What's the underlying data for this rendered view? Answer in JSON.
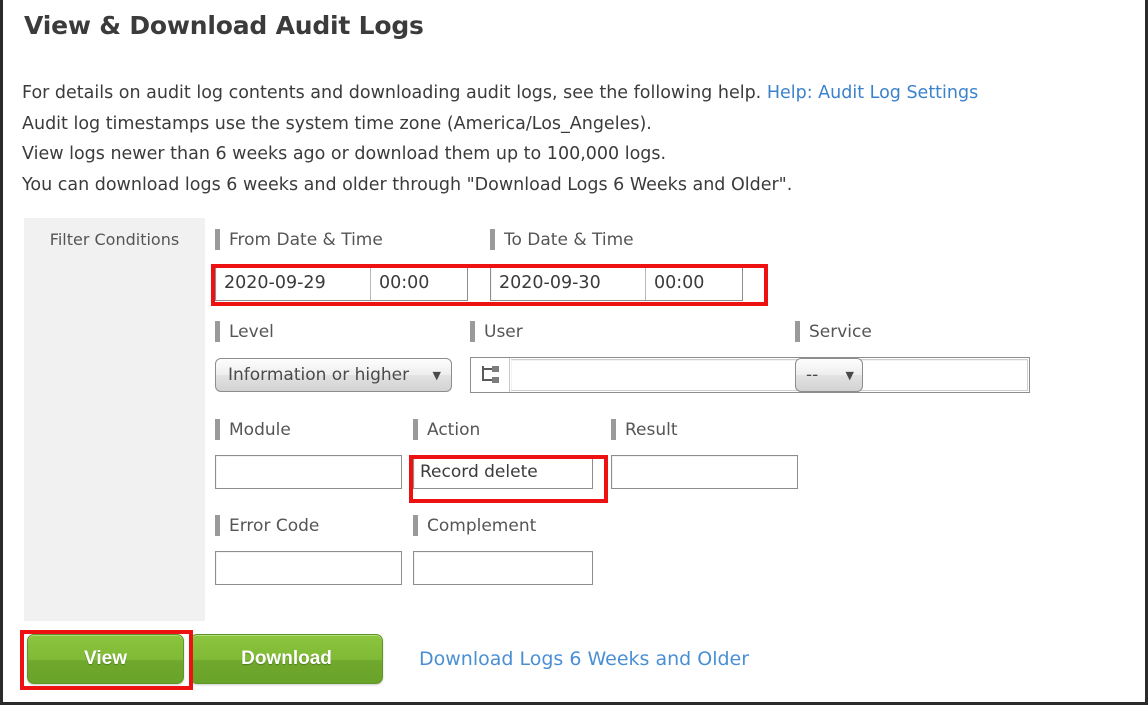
{
  "page": {
    "title": "View & Download Audit Logs",
    "description_lines": [
      "For details on audit log contents and downloading audit logs, see the following help. ",
      "Audit log timestamps use the system time zone (America/Los_Angeles).",
      "View logs newer than 6 weeks ago or download them up to 100,000 logs.",
      "You can download logs 6 weeks and older through \"Download Logs 6 Weeks and Older\"."
    ],
    "help_link_label": "Help: Audit Log Settings"
  },
  "filter_panel": {
    "title": "Filter Conditions"
  },
  "fields": {
    "from_datetime": {
      "label": "From Date & Time",
      "date_value": "2020-09-29",
      "time_value": "00:00"
    },
    "to_datetime": {
      "label": "To Date & Time",
      "date_value": "2020-09-30",
      "time_value": "00:00"
    },
    "level": {
      "label": "Level",
      "selected": "Information or higher",
      "caret": "▼"
    },
    "user": {
      "label": "User",
      "value": "",
      "picker_icon": "org-tree-picker-icon"
    },
    "service": {
      "label": "Service",
      "selected": "--",
      "caret": "▼"
    },
    "module": {
      "label": "Module",
      "value": ""
    },
    "action": {
      "label": "Action",
      "value": "Record delete"
    },
    "result": {
      "label": "Result",
      "value": ""
    },
    "error_code": {
      "label": "Error Code",
      "value": ""
    },
    "complement": {
      "label": "Complement",
      "value": ""
    }
  },
  "actions": {
    "view_label": "View",
    "download_label": "Download",
    "download_old_logs_link": "Download Logs 6 Weeks and Older"
  },
  "colors": {
    "highlight": "#ee1111",
    "button_green": "#7fb936",
    "link_blue": "#3b82cc",
    "panel_gray": "#f1f1f1"
  }
}
